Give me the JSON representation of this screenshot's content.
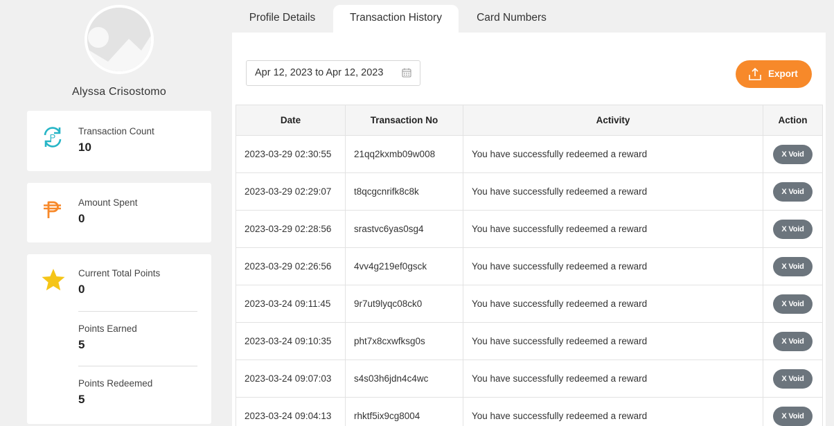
{
  "profile": {
    "name": "Alyssa Crisostomo"
  },
  "stats": {
    "transaction_count": {
      "label": "Transaction Count",
      "value": "10",
      "icon": "refresh-points-icon",
      "color": "#26b5c6"
    },
    "amount_spent": {
      "label": "Amount Spent",
      "value": "0",
      "icon": "peso-icon",
      "color": "#f7892a"
    },
    "current_total_points": {
      "label": "Current Total Points",
      "value": "0",
      "icon": "star-icon",
      "color": "#f5c518"
    },
    "points_earned": {
      "label": "Points Earned",
      "value": "5"
    },
    "points_redeemed": {
      "label": "Points Redeemed",
      "value": "5"
    }
  },
  "tabs": [
    {
      "label": "Profile Details",
      "active": false
    },
    {
      "label": "Transaction History",
      "active": true
    },
    {
      "label": "Card Numbers",
      "active": false
    }
  ],
  "filter": {
    "date_range": "Apr 12, 2023 to Apr 12, 2023"
  },
  "export_label": "Export",
  "accent_color": "#f7892a",
  "table": {
    "headers": [
      "Date",
      "Transaction No",
      "Activity",
      "Action"
    ],
    "rows": [
      {
        "date": "2023-03-29 02:30:55",
        "txn": "21qq2kxmb09w008",
        "activity": "You have successfully redeemed a reward",
        "action": "X Void"
      },
      {
        "date": "2023-03-29 02:29:07",
        "txn": "t8qcgcnrifk8c8k",
        "activity": "You have successfully redeemed a reward",
        "action": "X Void"
      },
      {
        "date": "2023-03-29 02:28:56",
        "txn": "srastvc6yas0sg4",
        "activity": "You have successfully redeemed a reward",
        "action": "X Void"
      },
      {
        "date": "2023-03-29 02:26:56",
        "txn": "4vv4g219ef0gsck",
        "activity": "You have successfully redeemed a reward",
        "action": "X Void"
      },
      {
        "date": "2023-03-24 09:11:45",
        "txn": "9r7ut9lyqc08ck0",
        "activity": "You have successfully redeemed a reward",
        "action": "X Void"
      },
      {
        "date": "2023-03-24 09:10:35",
        "txn": "pht7x8cxwfksg0s",
        "activity": "You have successfully redeemed a reward",
        "action": "X Void"
      },
      {
        "date": "2023-03-24 09:07:03",
        "txn": "s4s03h6jdn4c4wc",
        "activity": "You have successfully redeemed a reward",
        "action": "X Void"
      },
      {
        "date": "2023-03-24 09:04:13",
        "txn": "rhktf5ix9cg8004",
        "activity": "You have successfully redeemed a reward",
        "action": "X Void"
      }
    ]
  }
}
